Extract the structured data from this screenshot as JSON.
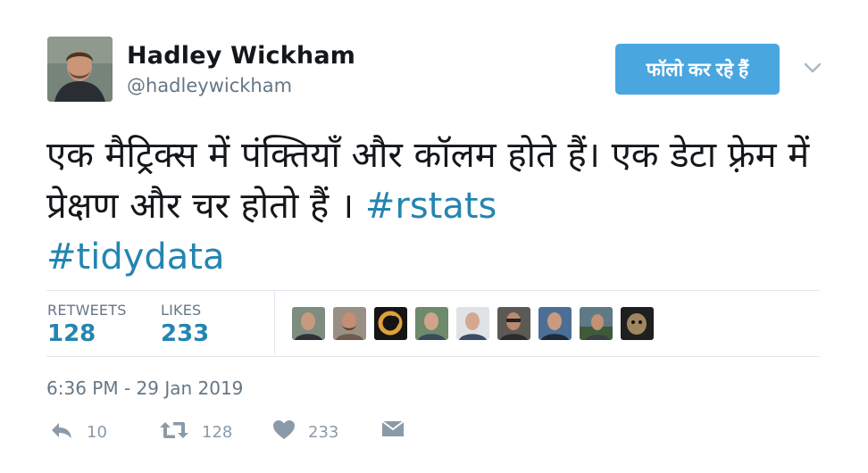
{
  "author": {
    "name": "Hadley Wickham",
    "handle": "@hadleywickham"
  },
  "follow_button": {
    "label": "फॉलो कर रहे हैं"
  },
  "tweet": {
    "text": "एक मैट्रिक्स में पंक्तियाँ और कॉलम होते हैं। एक डेटा फ़्रेम में प्रेक्षण और चर होतो हैं ।",
    "hashtags": [
      "#rstats",
      "#tidydata"
    ]
  },
  "stats": {
    "retweets_label": "RETWEETS",
    "retweets": "128",
    "likes_label": "LIKES",
    "likes": "233"
  },
  "timestamp": "6:36 PM - 29 Jan 2019",
  "actions": {
    "reply_count": "10",
    "retweet_count": "128",
    "like_count": "233"
  },
  "colors": {
    "follow_button": "#4aa6df",
    "hashtag": "#2485b0",
    "stat_value": "#2485b0",
    "muted": "#657786",
    "divider": "#e1e8ed"
  },
  "icons": [
    "caret-down-icon",
    "reply-icon",
    "retweet-icon",
    "heart-icon",
    "message-icon"
  ]
}
